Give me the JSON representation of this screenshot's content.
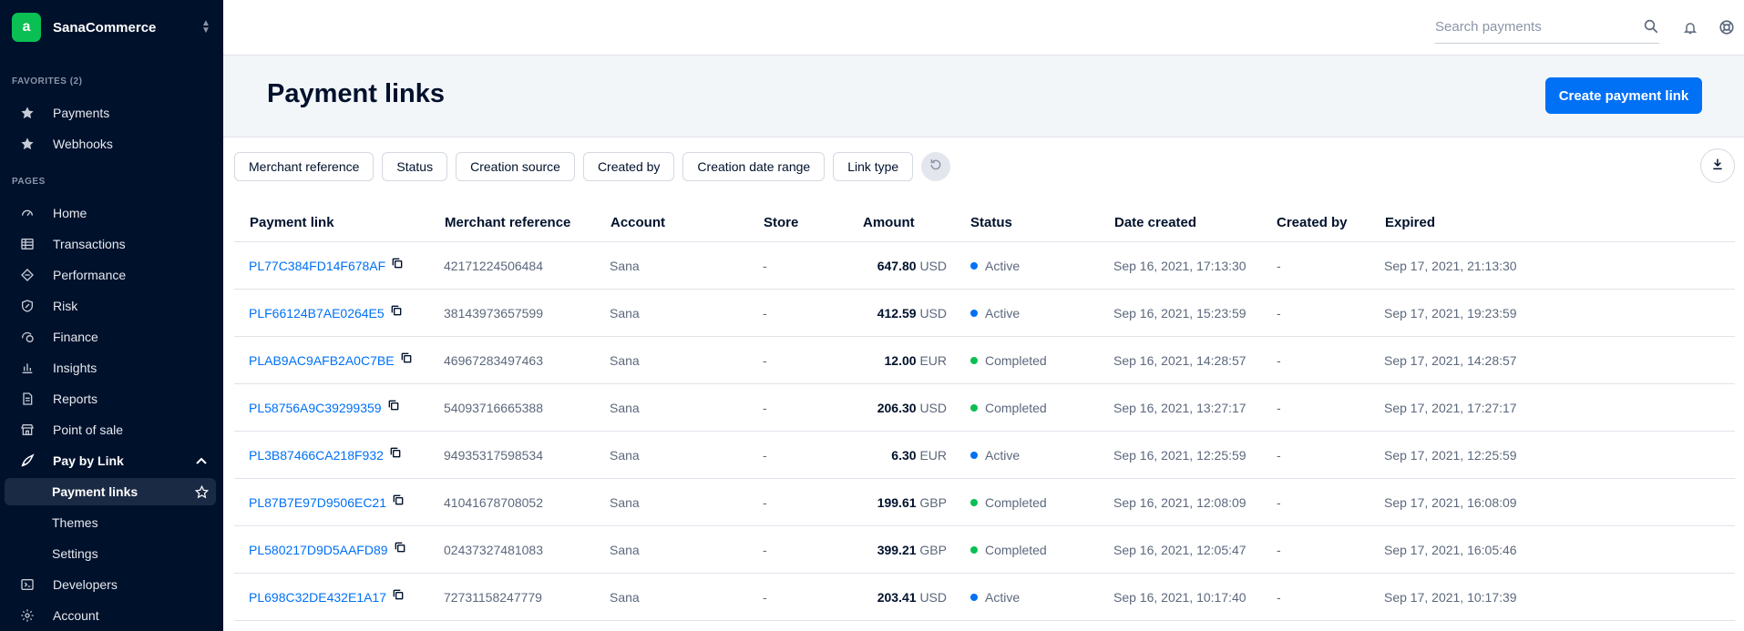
{
  "app": {
    "name": "SanaCommerce",
    "logo_letter": "a"
  },
  "sidebar": {
    "favorites_label": "FAVORITES (2)",
    "favorites": [
      {
        "label": "Payments",
        "icon": "star-icon"
      },
      {
        "label": "Webhooks",
        "icon": "star-icon"
      }
    ],
    "pages_label": "PAGES",
    "pages": [
      {
        "label": "Home",
        "icon": "home-gauge-icon"
      },
      {
        "label": "Transactions",
        "icon": "table-icon"
      },
      {
        "label": "Performance",
        "icon": "performance-diamond-icon"
      },
      {
        "label": "Risk",
        "icon": "shield-icon"
      },
      {
        "label": "Finance",
        "icon": "finance-icon"
      },
      {
        "label": "Insights",
        "icon": "bar-chart-icon"
      },
      {
        "label": "Reports",
        "icon": "document-icon"
      },
      {
        "label": "Point of sale",
        "icon": "store-icon"
      },
      {
        "label": "Pay by Link",
        "icon": "rocket-icon",
        "expanded": true
      }
    ],
    "pay_by_link_sub": [
      {
        "label": "Payment links",
        "active": true
      },
      {
        "label": "Themes"
      },
      {
        "label": "Settings"
      }
    ],
    "bottom": [
      {
        "label": "Developers",
        "icon": "terminal-icon"
      },
      {
        "label": "Account",
        "icon": "gear-icon"
      }
    ]
  },
  "topbar": {
    "search_placeholder": "Search payments"
  },
  "header": {
    "title": "Payment links",
    "create_button": "Create payment link"
  },
  "filters": [
    "Merchant reference",
    "Status",
    "Creation source",
    "Created by",
    "Creation date range",
    "Link type"
  ],
  "table": {
    "columns": [
      "Payment link",
      "Merchant reference",
      "Account",
      "Store",
      "Amount",
      "Status",
      "Date created",
      "Created by",
      "Expired"
    ],
    "rows": [
      {
        "link": "PL77C384FD14F678AF",
        "ref": "42171224506484",
        "account": "Sana",
        "store": "-",
        "amount": "647.80",
        "currency": "USD",
        "status": "Active",
        "created": "Sep 16, 2021, 17:13:30",
        "created_by": "-",
        "expired": "Sep 17, 2021, 21:13:30"
      },
      {
        "link": "PLF66124B7AE0264E5",
        "ref": "38143973657599",
        "account": "Sana",
        "store": "-",
        "amount": "412.59",
        "currency": "USD",
        "status": "Active",
        "created": "Sep 16, 2021, 15:23:59",
        "created_by": "-",
        "expired": "Sep 17, 2021, 19:23:59"
      },
      {
        "link": "PLAB9AC9AFB2A0C7BE",
        "ref": "46967283497463",
        "account": "Sana",
        "store": "-",
        "amount": "12.00",
        "currency": "EUR",
        "status": "Completed",
        "created": "Sep 16, 2021, 14:28:57",
        "created_by": "-",
        "expired": "Sep 17, 2021, 14:28:57"
      },
      {
        "link": "PL58756A9C39299359",
        "ref": "54093716665388",
        "account": "Sana",
        "store": "-",
        "amount": "206.30",
        "currency": "USD",
        "status": "Completed",
        "created": "Sep 16, 2021, 13:27:17",
        "created_by": "-",
        "expired": "Sep 17, 2021, 17:27:17"
      },
      {
        "link": "PL3B87466CA218F932",
        "ref": "94935317598534",
        "account": "Sana",
        "store": "-",
        "amount": "6.30",
        "currency": "EUR",
        "status": "Active",
        "created": "Sep 16, 2021, 12:25:59",
        "created_by": "-",
        "expired": "Sep 17, 2021, 12:25:59"
      },
      {
        "link": "PL87B7E97D9506EC21",
        "ref": "41041678708052",
        "account": "Sana",
        "store": "-",
        "amount": "199.61",
        "currency": "GBP",
        "status": "Completed",
        "created": "Sep 16, 2021, 12:08:09",
        "created_by": "-",
        "expired": "Sep 17, 2021, 16:08:09"
      },
      {
        "link": "PL580217D9D5AAFD89",
        "ref": "02437327481083",
        "account": "Sana",
        "store": "-",
        "amount": "399.21",
        "currency": "GBP",
        "status": "Completed",
        "created": "Sep 16, 2021, 12:05:47",
        "created_by": "-",
        "expired": "Sep 17, 2021, 16:05:46"
      },
      {
        "link": "PL698C32DE432E1A17",
        "ref": "72731158247779",
        "account": "Sana",
        "store": "-",
        "amount": "203.41",
        "currency": "USD",
        "status": "Active",
        "created": "Sep 16, 2021, 10:17:40",
        "created_by": "-",
        "expired": "Sep 17, 2021, 10:17:39"
      }
    ]
  },
  "colors": {
    "sidebar_bg": "#00112c",
    "primary": "#0070f5",
    "active_dot": "#0070f5",
    "completed_dot": "#0abf53",
    "brand": "#0abf53"
  }
}
